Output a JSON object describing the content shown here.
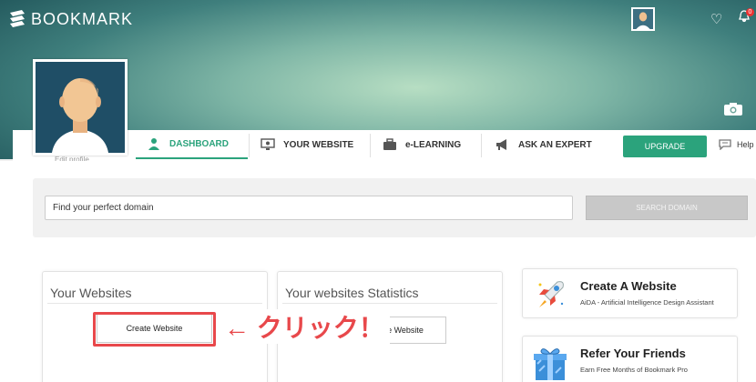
{
  "header": {
    "logo_text": "BOOKMARK",
    "notification_count": "0"
  },
  "profile": {
    "edit_label": "Edit profile"
  },
  "tabs": [
    {
      "label": "DASHBOARD",
      "icon": "dashboard-person-icon",
      "active": true
    },
    {
      "label": "YOUR WEBSITE",
      "icon": "monitor-icon",
      "active": false
    },
    {
      "label": "e-LEARNING",
      "icon": "briefcase-icon",
      "active": false
    },
    {
      "label": "ASK AN EXPERT",
      "icon": "megaphone-icon",
      "active": false
    }
  ],
  "upgrade_label": "UPGRADE",
  "help_label": "Help",
  "search": {
    "value": "Find your perfect domain",
    "button_label": "SEARCH DOMAIN"
  },
  "websites_card": {
    "title": "Your Websites",
    "create_button": "Create Website"
  },
  "stats_card": {
    "title": "Your websites Statistics",
    "partial_button": "Create Website"
  },
  "annotation": "← クリック！",
  "right_cards": [
    {
      "title": "Create A Website",
      "subtitle": "AiDA - Artificial Intelligence Design Assistant",
      "icon": "rocket-icon"
    },
    {
      "title": "Refer Your Friends",
      "subtitle": "Earn Free Months of Bookmark Pro",
      "icon": "gift-icon"
    }
  ],
  "colors": {
    "accent": "#2ba37c",
    "annotation": "#e8484b"
  }
}
